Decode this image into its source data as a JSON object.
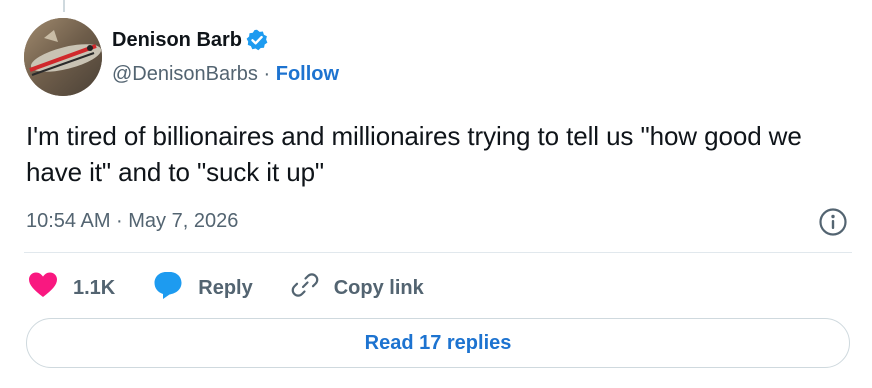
{
  "author": {
    "display_name": "Denison Barb",
    "handle": "@DenisonBarbs",
    "separator": "·",
    "follow_label": "Follow",
    "verified_icon": "verified-badge-icon",
    "verified_color": "#1d9bf0"
  },
  "tweet": {
    "text": "I'm tired of billionaires and millionaires trying to tell us \"how good we have it\" and to \"suck it up\"",
    "timestamp": "10:54 AM · May 7, 2026"
  },
  "actions": {
    "likes_count": "1.1K",
    "like_icon": "heart-icon",
    "like_color": "#f91880",
    "reply_label": "Reply",
    "reply_icon": "speech-bubble-icon",
    "reply_color": "#1d9bf0",
    "copy_link_label": "Copy link",
    "copy_link_icon": "link-icon"
  },
  "footer": {
    "read_replies_label": "Read 17 replies"
  },
  "colors": {
    "link_blue": "#1d73d0",
    "secondary_text": "#536471",
    "primary_text": "#0f1419",
    "border": "#cfd9de"
  }
}
